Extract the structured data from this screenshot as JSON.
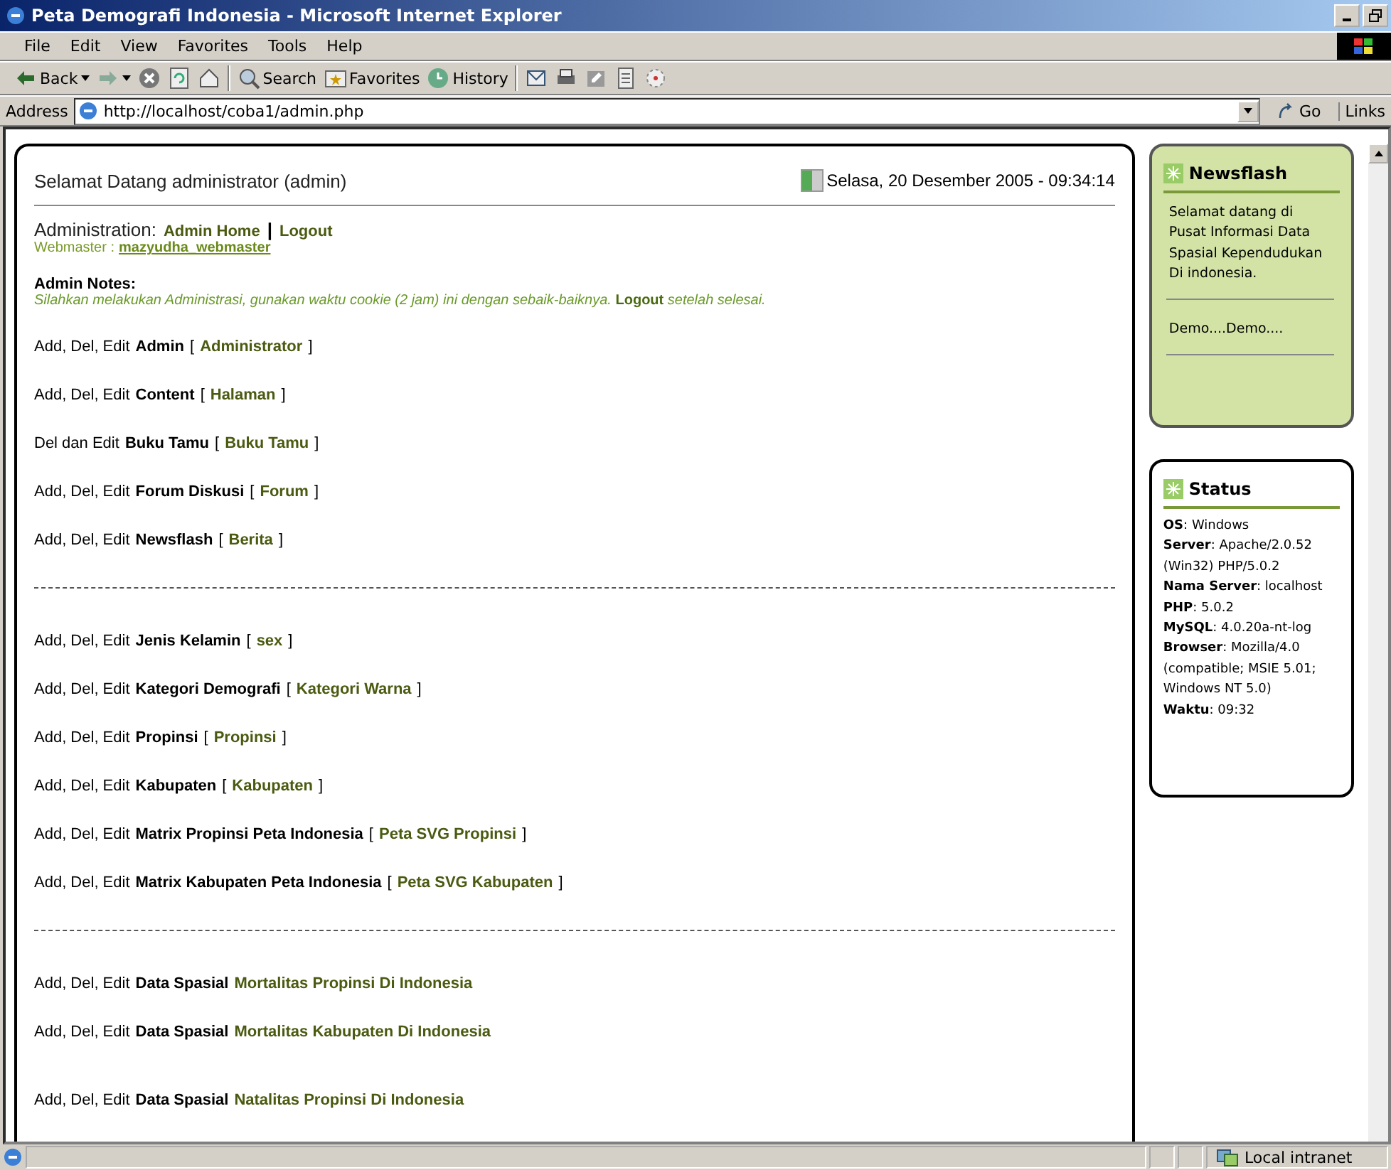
{
  "window": {
    "title": "Peta Demografi Indonesia - Microsoft Internet Explorer"
  },
  "menu": [
    "File",
    "Edit",
    "View",
    "Favorites",
    "Tools",
    "Help"
  ],
  "toolbar": [
    {
      "kind": "back",
      "label": "Back"
    },
    {
      "kind": "forward"
    },
    {
      "kind": "stop"
    },
    {
      "kind": "refresh"
    },
    {
      "kind": "home"
    },
    {
      "kind": "search",
      "label": "Search"
    },
    {
      "kind": "favorites",
      "label": "Favorites"
    },
    {
      "kind": "history",
      "label": "History"
    },
    {
      "kind": "mail"
    },
    {
      "kind": "print"
    },
    {
      "kind": "edit"
    },
    {
      "kind": "discuss"
    },
    {
      "kind": "messenger"
    }
  ],
  "address": {
    "label": "Address",
    "value": "http://localhost/coba1/admin.php",
    "go": "Go",
    "links": "Links"
  },
  "main": {
    "greeting": "Selamat Datang administrator (admin)",
    "date": "Selasa, 20 Desember 2005 - 09:34:14",
    "admin_label": "Administration:",
    "admin_links": [
      "Admin Home",
      "Logout"
    ],
    "separator": "|",
    "webmaster_label": "Webmaster :",
    "webmaster": "mazyudha_webmaster",
    "notes_title": "Admin Notes:",
    "notes": "Silahkan melakukan Administrasi, gunakan waktu cookie (2 jam) ini dengan sebaik-baiknya. **Logout** setelah selesai.",
    "rows": [
      {
        "kind": "item",
        "prefix": "Add, Del, Edit",
        "name": "Admin",
        "open": "[",
        "link": "Administrator",
        "close": "]"
      },
      {
        "kind": "item",
        "prefix": "Add, Del, Edit",
        "name": "Content",
        "open": "[",
        "link": "Halaman",
        "close": "]"
      },
      {
        "kind": "item",
        "prefix": "Del dan Edit",
        "name": "Buku Tamu",
        "open": "[",
        "link": "Buku Tamu",
        "close": "]"
      },
      {
        "kind": "item",
        "prefix": "Add, Del, Edit",
        "name": "Forum Diskusi",
        "open": "[",
        "link": "Forum",
        "close": "]"
      },
      {
        "kind": "item",
        "prefix": "Add, Del, Edit",
        "name": "Newsflash",
        "open": "[",
        "link": "Berita",
        "close": "]"
      },
      {
        "kind": "divider"
      },
      {
        "kind": "item",
        "prefix": "Add, Del, Edit",
        "name": "Jenis Kelamin",
        "open": "[",
        "link": "sex",
        "close": "]"
      },
      {
        "kind": "item",
        "prefix": "Add, Del, Edit",
        "name": "Kategori Demografi",
        "open": "[",
        "link": "Kategori Warna",
        "close": "]"
      },
      {
        "kind": "item",
        "prefix": "Add, Del, Edit",
        "name": "Propinsi",
        "open": "[",
        "link": "Propinsi",
        "close": "]"
      },
      {
        "kind": "item",
        "prefix": "Add, Del, Edit",
        "name": "Kabupaten",
        "open": "[",
        "link": "Kabupaten",
        "close": "]"
      },
      {
        "kind": "item",
        "prefix": "Add, Del, Edit",
        "name": "Matrix Propinsi Peta Indonesia",
        "open": "[",
        "link": "Peta SVG Propinsi",
        "close": "]"
      },
      {
        "kind": "item",
        "prefix": "Add, Del, Edit",
        "name": "Matrix Kabupaten Peta Indonesia",
        "open": "[",
        "link": "Peta SVG Kabupaten",
        "close": "]"
      },
      {
        "kind": "divider"
      },
      {
        "kind": "item",
        "prefix": "Add, Del, Edit",
        "name": "Data Spasial",
        "link": "Mortalitas Propinsi Di Indonesia"
      },
      {
        "kind": "item",
        "prefix": "Add, Del, Edit",
        "name": "Data Spasial",
        "link": "Mortalitas Kabupaten Di Indonesia"
      },
      {
        "kind": "gap"
      },
      {
        "kind": "item",
        "prefix": "Add, Del, Edit",
        "name": "Data Spasial",
        "link": "Natalitas Propinsi Di Indonesia"
      }
    ]
  },
  "newsflash": {
    "title": "Newsflash",
    "items": [
      "Selamat datang di Pusat Informasi Data Spasial Kependudukan Di indonesia.",
      "Demo....Demo...."
    ]
  },
  "status": {
    "title": "Status",
    "items": [
      "**OS**: Windows",
      "**Server**: Apache/2.0.52 (Win32) PHP/5.0.2",
      "**Nama Server**: localhost",
      "**PHP**: 5.0.2",
      "**MySQL**: 4.0.20a-nt-log",
      "**Browser**: Mozilla/4.0 (compatible; MSIE 5.01; Windows NT 5.0)",
      "**Waktu**: 09:32"
    ]
  },
  "status_bar": {
    "zone": "Local intranet"
  }
}
